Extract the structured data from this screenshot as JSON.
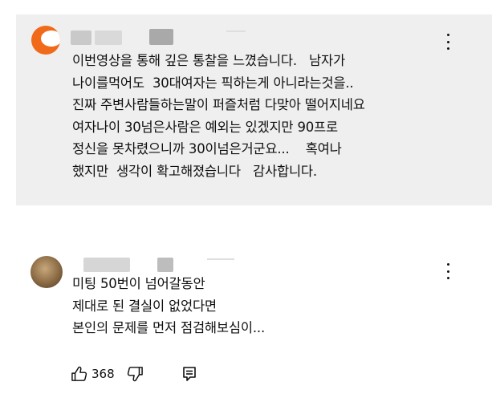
{
  "comments": [
    {
      "text": "이번영상을 통해 깊은 통찰을 느꼈습니다.   남자가\n나이를먹어도  30대여자는 픽하는게 아니라는것을..\n진짜 주변사람들하는말이 퍼즐처럼 다맞아 떨어지네요\n여자나이 30넘은사람은 예외는 있겠지만 90프로\n정신을 못차렸으니까 30이넘은거군요...    혹여나\n했지만  생각이 확고해졌습니다   감사합니다.",
      "avatar_icon": "avatar-orange-icon",
      "more_icon": "more-vert-icon"
    },
    {
      "text": "미팅 50번이 넘어갈동안\n제대로 된 결실이 없었다면\n본인의 문제를 먼저 점검해보심이...",
      "avatar_icon": "avatar-photo-icon",
      "more_icon": "more-vert-icon",
      "likes": "368",
      "like_icon": "thumb-up-icon",
      "dislike_icon": "thumb-down-icon",
      "reply_icon": "reply-icon"
    }
  ],
  "colors": {
    "highlight_bg": "#efefef",
    "text": "#0f0f0f",
    "avatar_orange": "#f06a1a"
  }
}
